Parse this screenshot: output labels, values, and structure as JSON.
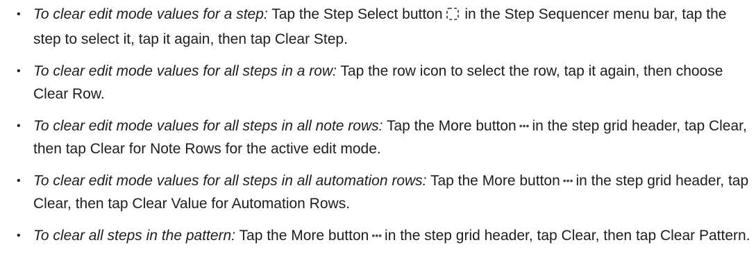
{
  "items": [
    {
      "lead": "To clear edit mode values for a step:",
      "before": " Tap the Step Select button",
      "icon": "step-select-icon",
      "after": " in the Step Sequencer menu bar, tap the step to select it, tap it again, then tap Clear Step."
    },
    {
      "lead": "To clear edit mode values for all steps in a row:",
      "before": " Tap the row icon to select the row, tap it again, then choose Clear Row.",
      "icon": "",
      "after": ""
    },
    {
      "lead": "To clear edit mode values for all steps in all note rows:",
      "before": " Tap the More button",
      "icon": "more-icon",
      "after": "in the step grid header, tap Clear, then tap Clear for Note Rows for the active edit mode."
    },
    {
      "lead": "To clear edit mode values for all steps in all automation rows:",
      "before": " Tap the More button",
      "icon": "more-icon",
      "after": "in the step grid header, tap Clear, then tap Clear Value for Automation Rows."
    },
    {
      "lead": "To clear all steps in the pattern:",
      "before": " Tap the More button",
      "icon": "more-icon",
      "after": "in the step grid header, tap Clear, then tap Clear Pattern."
    }
  ]
}
